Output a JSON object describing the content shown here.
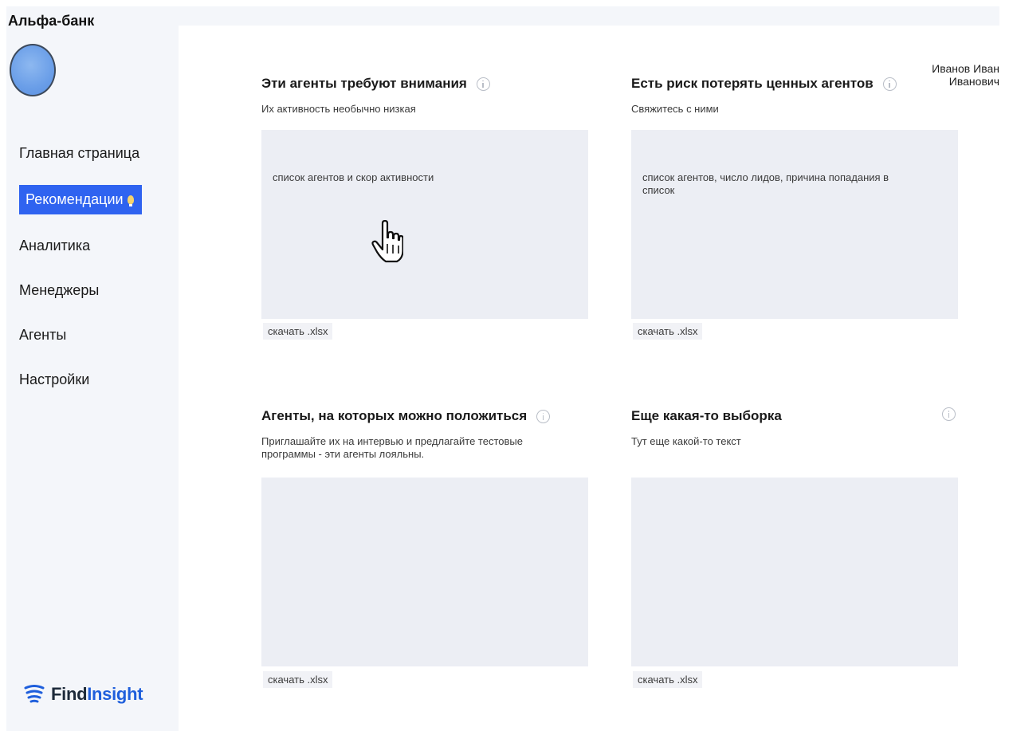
{
  "sidebar": {
    "bank_name": "Альфа-банк",
    "user_name": "Иванов Иван Иванович",
    "nav": [
      {
        "label": "Главная страница",
        "active": false
      },
      {
        "label": "Рекомендации",
        "active": true,
        "icon": "lightbulb-icon"
      },
      {
        "label": "Аналитика",
        "active": false
      },
      {
        "label": "Менеджеры",
        "active": false
      },
      {
        "label": "Агенты",
        "active": false
      },
      {
        "label": "Настройки",
        "active": false
      }
    ],
    "logo": {
      "part1": "Find",
      "part2": "Insight"
    }
  },
  "cards": [
    {
      "title": "Эти агенты требуют внимания",
      "subtitle": "Их активность необычно низкая",
      "box_text": "список агентов и скор активности",
      "download": "скачать .xlsx"
    },
    {
      "title": "Есть риск потерять ценных агентов",
      "subtitle": "Свяжитесь с ними",
      "box_text": "список агентов, число лидов, причина попадания в список",
      "download": "скачать .xlsx"
    },
    {
      "title": "Агенты, на которых можно положиться",
      "subtitle": "Приглашайте их на интервью и предлагайте тестовые программы - эти агенты лояльны.",
      "box_text": "",
      "download": "скачать .xlsx"
    },
    {
      "title": "Еще какая-то выборка",
      "subtitle": "Тут еще какой-то текст",
      "box_text": "",
      "download": "скачать .xlsx"
    }
  ],
  "colors": {
    "accent": "#2f63f0",
    "sidebar_bg": "#f4f6fa",
    "box_bg": "#eceef4"
  },
  "icons": [
    "info-icon",
    "lightbulb-icon",
    "hand-pointer-icon",
    "findinsight-logo-icon"
  ]
}
